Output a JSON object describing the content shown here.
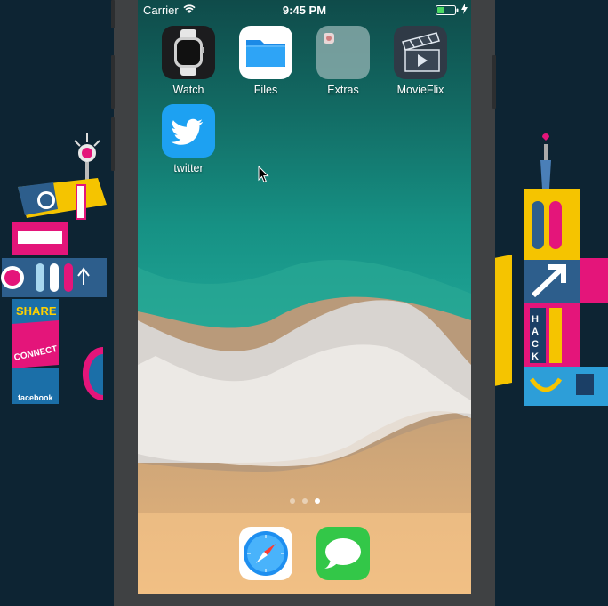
{
  "status_bar": {
    "carrier": "Carrier",
    "time": "9:45 PM",
    "battery_color": "#4cd964"
  },
  "apps": [
    {
      "label": "Watch",
      "icon": "watch-icon",
      "color": "#1c1c1e"
    },
    {
      "label": "Files",
      "icon": "folder-icon",
      "color": "#ffffff"
    },
    {
      "label": "Extras",
      "icon": "extras-folder-icon",
      "color": "#8bb2b4"
    },
    {
      "label": "MovieFlix",
      "icon": "clapperboard-icon",
      "color": "#3a4654"
    },
    {
      "label": "twitter",
      "icon": "twitter-bird-icon",
      "color": "#1da1f2"
    }
  ],
  "page_indicator": {
    "count": 3,
    "active": 3
  },
  "dock": [
    {
      "label": "Safari",
      "icon": "compass-icon"
    },
    {
      "label": "Messages",
      "icon": "speech-bubble-icon"
    }
  ],
  "desktop": {
    "left_art": "facebook",
    "left_art_words": [
      "SHARE",
      "CONNECT"
    ],
    "right_art_word": "HACK"
  }
}
